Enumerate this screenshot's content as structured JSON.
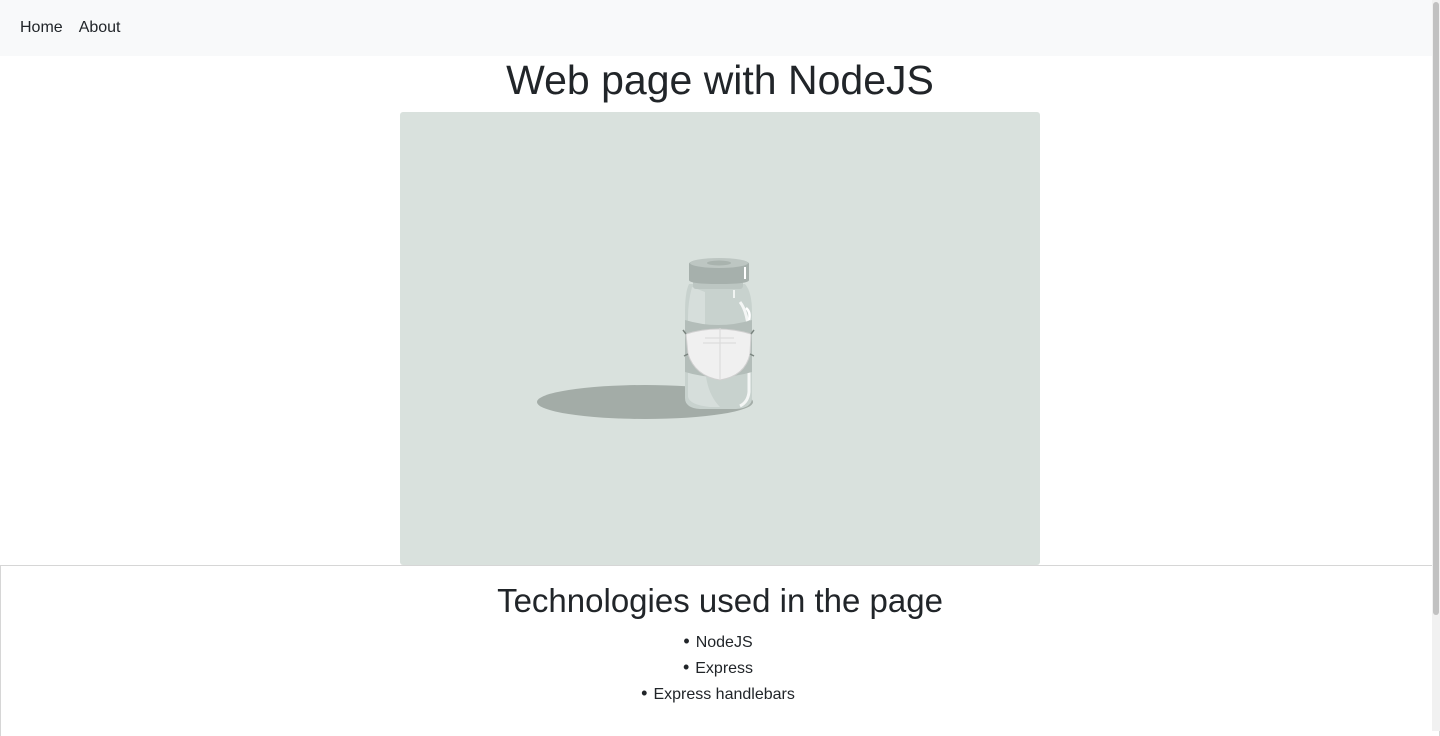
{
  "nav": {
    "links": [
      {
        "label": "Home"
      },
      {
        "label": "About"
      }
    ]
  },
  "main": {
    "title": "Web page with NodeJS",
    "hero_image": {
      "subject": "vaccine-vial-with-mask",
      "background": "#d9e1dd"
    }
  },
  "technologies": {
    "heading": "Technologies used in the page",
    "items": [
      "NodeJS",
      "Express",
      "Express handlebars"
    ]
  },
  "colors": {
    "navbar_bg": "#f8f9fa",
    "text": "#212529"
  }
}
